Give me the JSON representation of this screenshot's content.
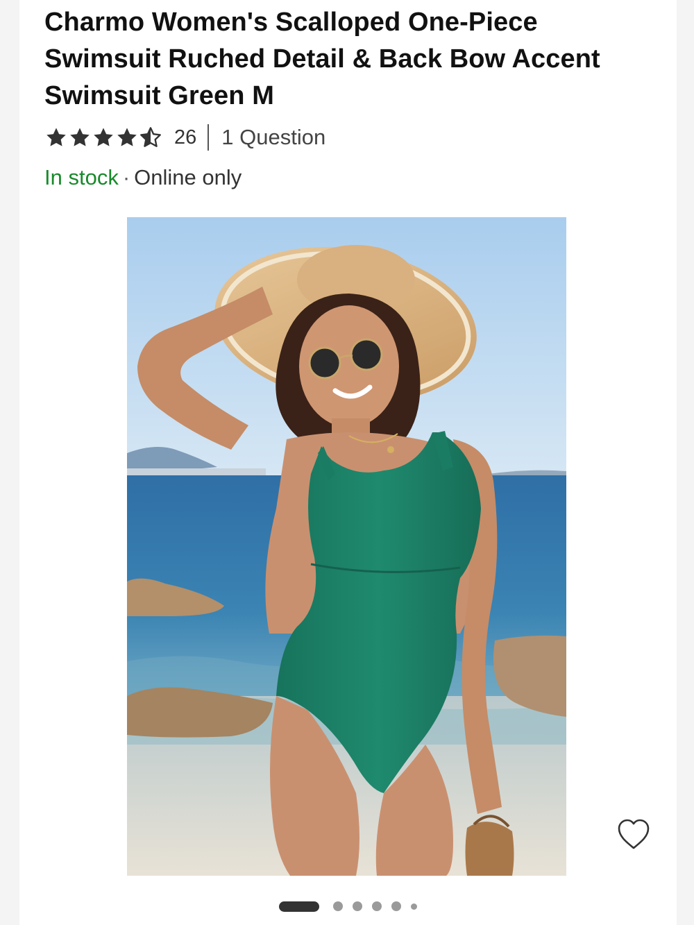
{
  "product": {
    "title": "Charmo Women's Scalloped One-Piece Swimsuit Ruched Detail & Back Bow Accent Swimsuit Green M",
    "rating": 4.5,
    "rating_max": 5,
    "review_count": "26",
    "questions_label": "1 Question",
    "stock_status": "In stock",
    "stock_separator": "·",
    "availability": "Online only"
  },
  "image": {
    "alt": "Woman in green scalloped one-piece swimsuit and straw hat on a beach",
    "current_index": 1,
    "total_dots": 6
  },
  "icons": {
    "star": "star-icon",
    "wishlist": "heart-outline-icon"
  },
  "colors": {
    "star_fill": "#333333",
    "in_stock": "#188a2b",
    "swimsuit": "#1f8a6e",
    "pager_active": "#333333",
    "pager_inactive": "#9a9a9a"
  }
}
